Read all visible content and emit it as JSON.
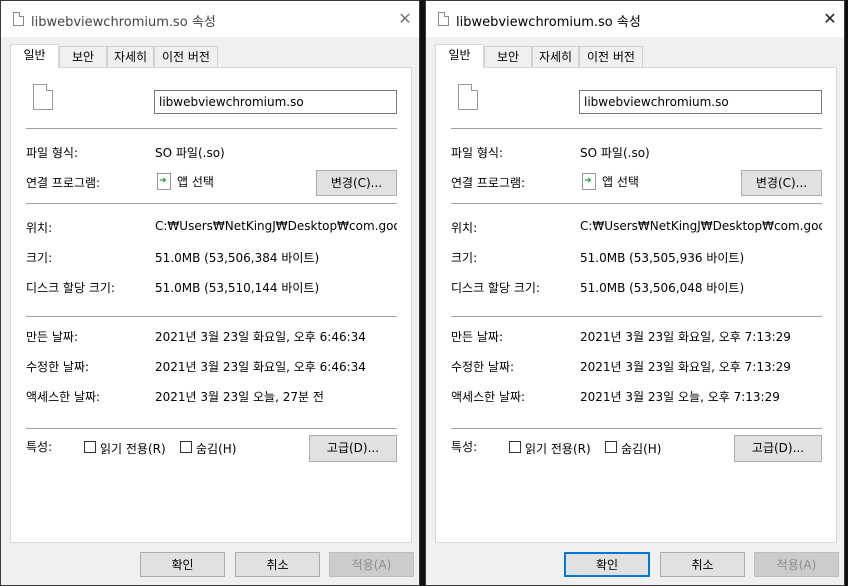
{
  "windows": [
    {
      "title": "libwebviewchromium.so 속성",
      "close_glyph": "✕",
      "tabs": [
        "일반",
        "보안",
        "자세히",
        "이전 버전"
      ],
      "filename": "libwebviewchromium.so",
      "file_type_label": "파일 형식:",
      "file_type": "SO 파일(.so)",
      "opens_with_label": "연결 프로그램:",
      "opens_with": "앱 선택",
      "change_button": "변경(C)...",
      "location_label": "위치:",
      "location": "C:₩Users₩NetKingJ₩Desktop₩com.google.ar",
      "size_label": "크기:",
      "size": "51.0MB (53,506,384 바이트)",
      "size_on_disk_label": "디스크 할당 크기:",
      "size_on_disk": "51.0MB (53,510,144 바이트)",
      "created_label": "만든 날짜:",
      "created": "2021년 3월 23일 화요일, 오후 6:46:34",
      "modified_label": "수정한 날짜:",
      "modified": "2021년 3월 23일 화요일, 오후 6:46:34",
      "accessed_label": "액세스한 날짜:",
      "accessed": "2021년 3월 23일 오늘, 27분 전",
      "attributes_label": "특성:",
      "readonly_label": "읽기 전용(R)",
      "hidden_label": "숨김(H)",
      "advanced_button": "고급(D)...",
      "ok_button": "확인",
      "cancel_button": "취소",
      "apply_button": "적용(A)"
    },
    {
      "title": "libwebviewchromium.so 속성",
      "close_glyph": "✕",
      "tabs": [
        "일반",
        "보안",
        "자세히",
        "이전 버전"
      ],
      "filename": "libwebviewchromium.so",
      "file_type_label": "파일 형식:",
      "file_type": "SO 파일(.so)",
      "opens_with_label": "연결 프로그램:",
      "opens_with": "앱 선택",
      "change_button": "변경(C)...",
      "location_label": "위치:",
      "location": "C:₩Users₩NetKingJ₩Desktop₩com.google.ar",
      "size_label": "크기:",
      "size": "51.0MB (53,505,936 바이트)",
      "size_on_disk_label": "디스크 할당 크기:",
      "size_on_disk": "51.0MB (53,506,048 바이트)",
      "created_label": "만든 날짜:",
      "created": "2021년 3월 23일 화요일, 오후 7:13:29",
      "modified_label": "수정한 날짜:",
      "modified": "2021년 3월 23일 화요일, 오후 7:13:29",
      "accessed_label": "액세스한 날짜:",
      "accessed": "2021년 3월 23일 오늘, 오후 7:13:29",
      "attributes_label": "특성:",
      "readonly_label": "읽기 전용(R)",
      "hidden_label": "숨김(H)",
      "advanced_button": "고급(D)...",
      "ok_button": "확인",
      "cancel_button": "취소",
      "apply_button": "적용(A)"
    }
  ],
  "icons": {
    "title_icon": "document-icon",
    "file_icon": "file-icon",
    "app_icon": "app-select-icon"
  },
  "colors": {
    "focus_accent": "#0078d7",
    "dialog_bg": "#f0f0f0",
    "panel_bg": "#ffffff"
  }
}
